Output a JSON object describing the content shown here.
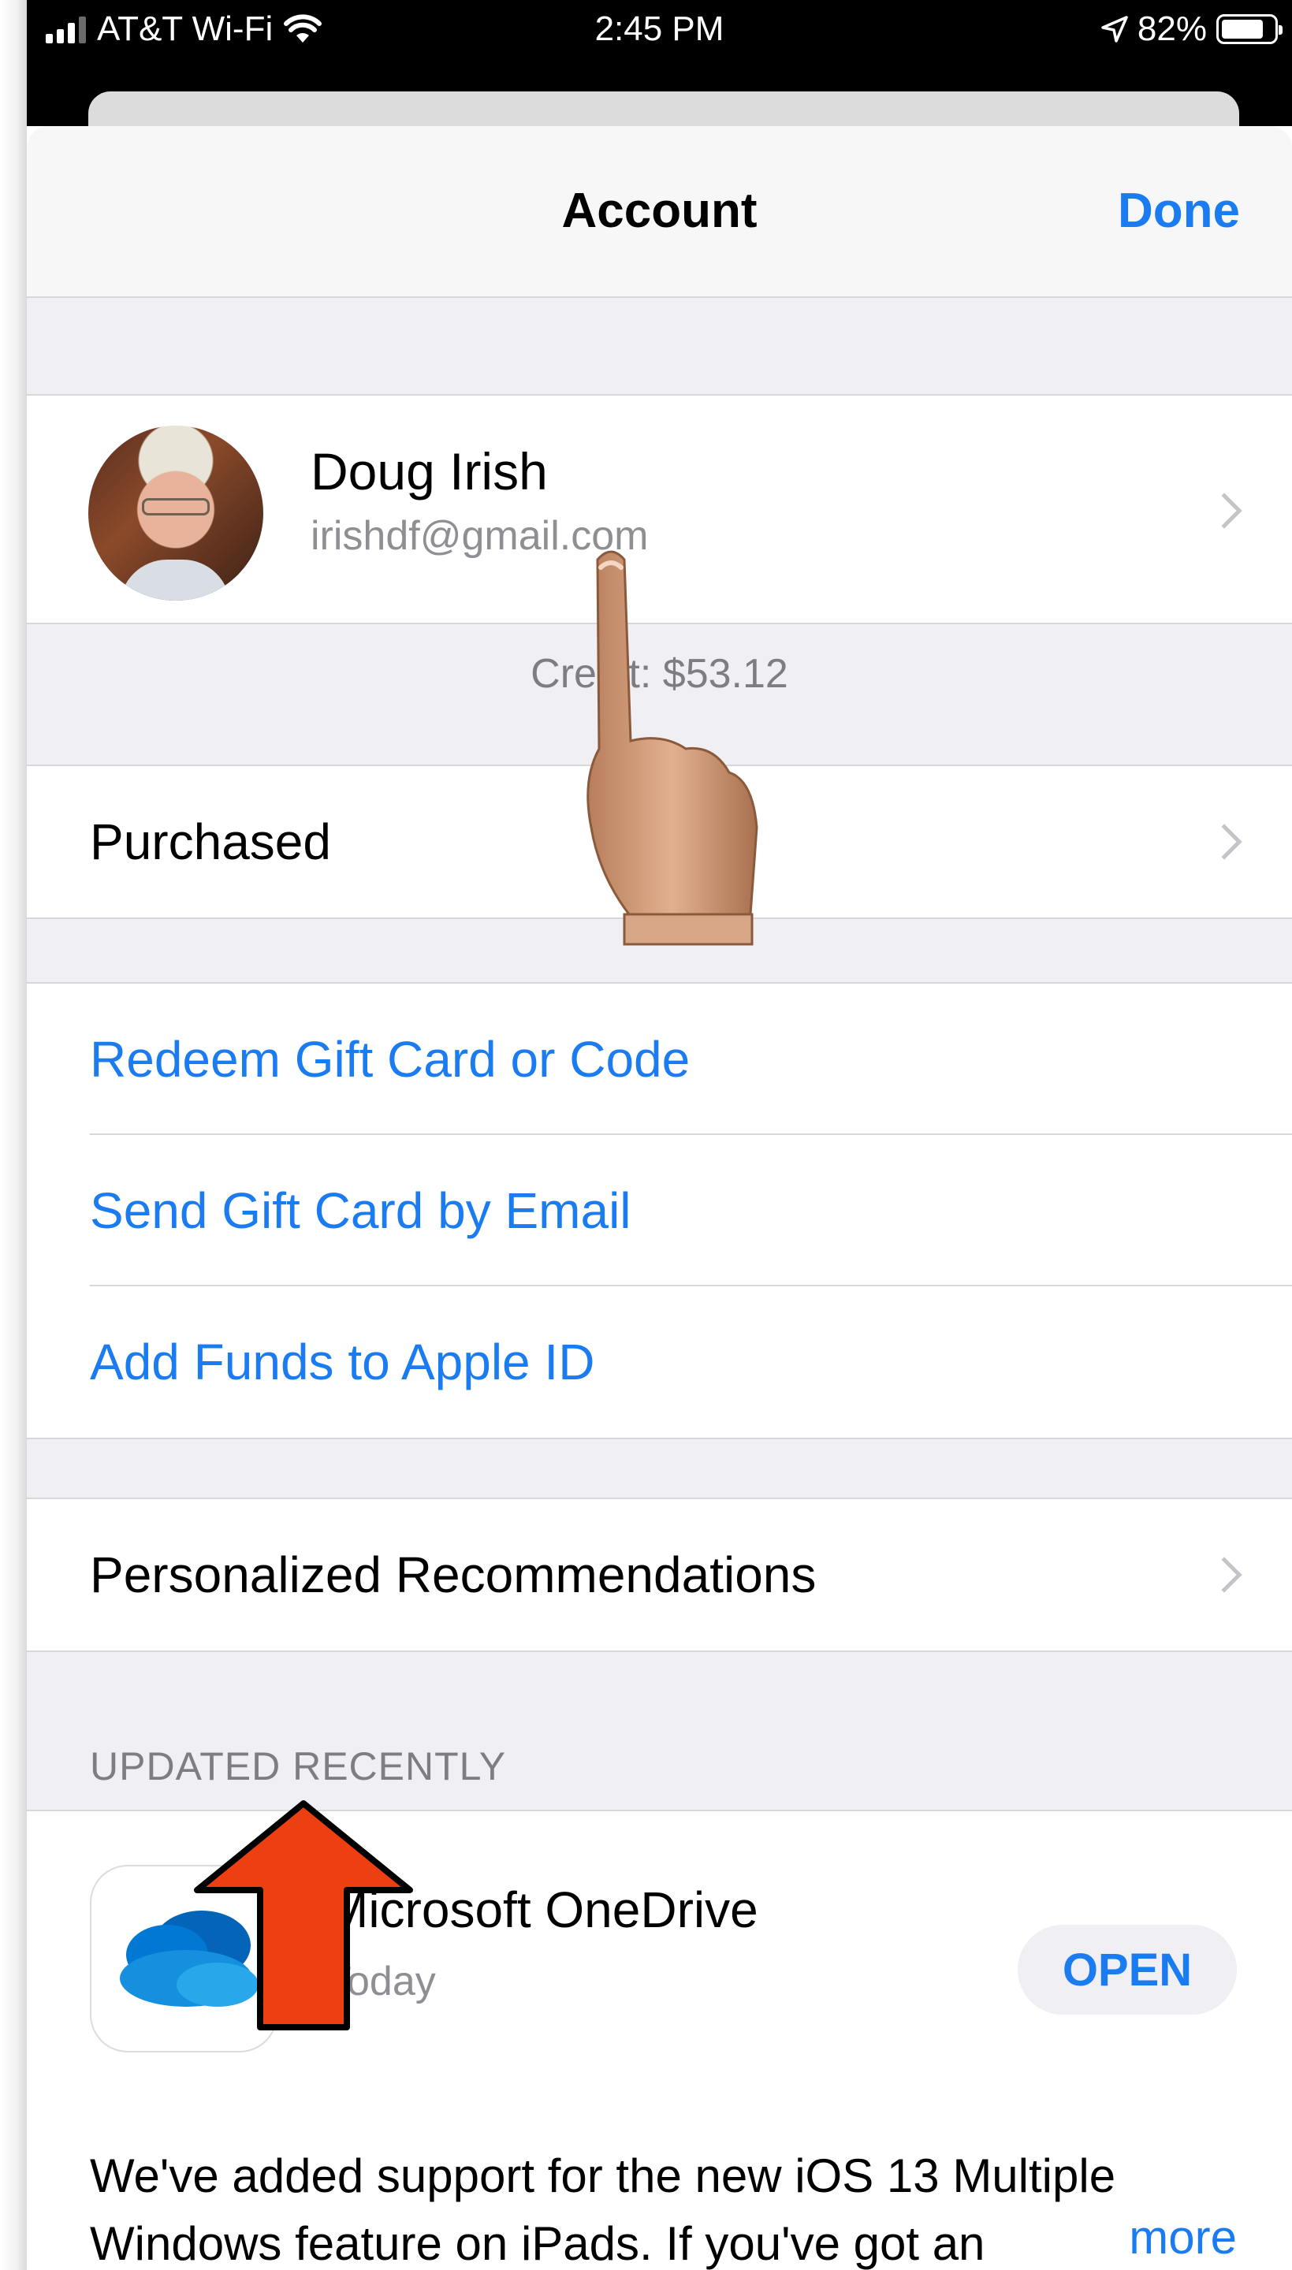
{
  "status_bar": {
    "carrier": "AT&T Wi-Fi",
    "time": "2:45 PM",
    "battery_percent": "82%",
    "battery_level": 0.82
  },
  "nav": {
    "title": "Account",
    "done_label": "Done"
  },
  "profile": {
    "name": "Doug Irish",
    "email": "irishdf@gmail.com"
  },
  "credit": "Credit: $53.12",
  "purchased_label": "Purchased",
  "links": [
    "Redeem Gift Card or Code",
    "Send Gift Card by Email",
    "Add Funds to Apple ID"
  ],
  "recommendations_label": "Personalized Recommendations",
  "updated_recently": {
    "header": "UPDATED RECENTLY",
    "app_name": "Microsoft OneDrive",
    "date": "Today",
    "open_label": "OPEN",
    "notes": "We've added support for the new iOS 13 Multiple Windows feature on iPads. If you've got an",
    "more_label": "more"
  },
  "colors": {
    "accent": "#1a7cf0",
    "annotation_arrow": "#ee3f12"
  },
  "icons": [
    "signal-icon",
    "wifi-icon",
    "location-icon",
    "battery-icon",
    "chevron-right-icon",
    "onedrive-cloud-icon",
    "pointing-hand-icon",
    "up-arrow-icon"
  ]
}
